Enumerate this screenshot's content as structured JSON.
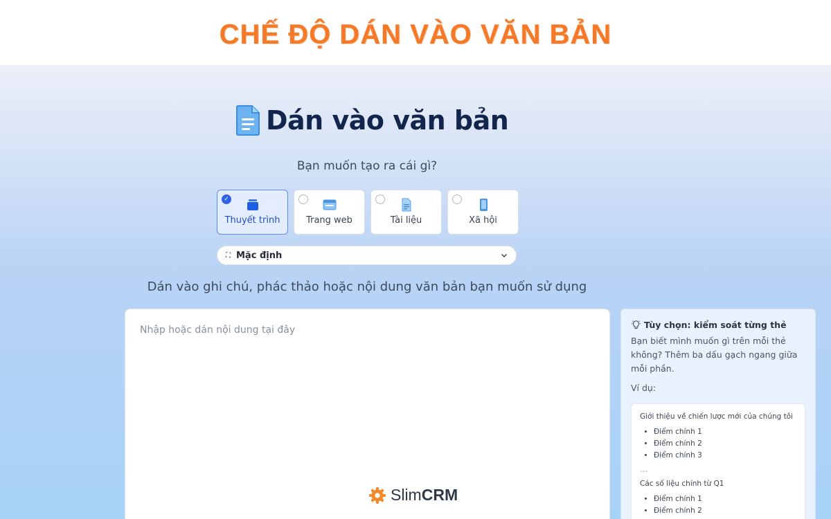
{
  "banner": {
    "title": "CHẾ ĐỘ DÁN VÀO VĂN BẢN"
  },
  "page": {
    "title": "Dán vào văn bản",
    "question": "Bạn muốn tạo ra cái gì?",
    "instruction": "Dán vào ghi chú, phác thảo hoặc nội dung văn bản bạn muốn sử dụng"
  },
  "types": [
    {
      "label": "Thuyết trình",
      "icon": "presentation-icon",
      "selected": true
    },
    {
      "label": "Trang web",
      "icon": "webpage-icon",
      "selected": false
    },
    {
      "label": "Tài liệu",
      "icon": "document-icon",
      "selected": false
    },
    {
      "label": "Xã hội",
      "icon": "social-icon",
      "selected": false
    }
  ],
  "theme_select": {
    "icon": "expand-icon",
    "value": "Mặc định"
  },
  "editor": {
    "placeholder": "Nhập hoặc dán nội dung tại đây"
  },
  "tips": {
    "title": "Tùy chọn: kiểm soát từng thẻ",
    "body": "Bạn biết mình muốn gì trên mỗi thẻ không? Thêm ba dấu gạch ngang  giữa mỗi phần.",
    "example_label": "Ví dụ:",
    "example": {
      "section1_heading": "Giới thiệu về chiến lược mới của chúng tôi",
      "section1_items": [
        "Điểm chính 1",
        "Điểm chính 2",
        "Điểm chính 3"
      ],
      "separator": "---",
      "section2_heading": "Các số liệu chính từ Q1",
      "section2_items": [
        "Điểm chính 1",
        "Điểm chính 2"
      ]
    }
  },
  "brand": {
    "name_light": "Slim",
    "name_bold": "CRM"
  },
  "colors": {
    "banner_orange": "#f47a2a",
    "title_navy": "#12254d",
    "accent_blue": "#2f63e4",
    "selected_card_bg": "#e3edff"
  }
}
